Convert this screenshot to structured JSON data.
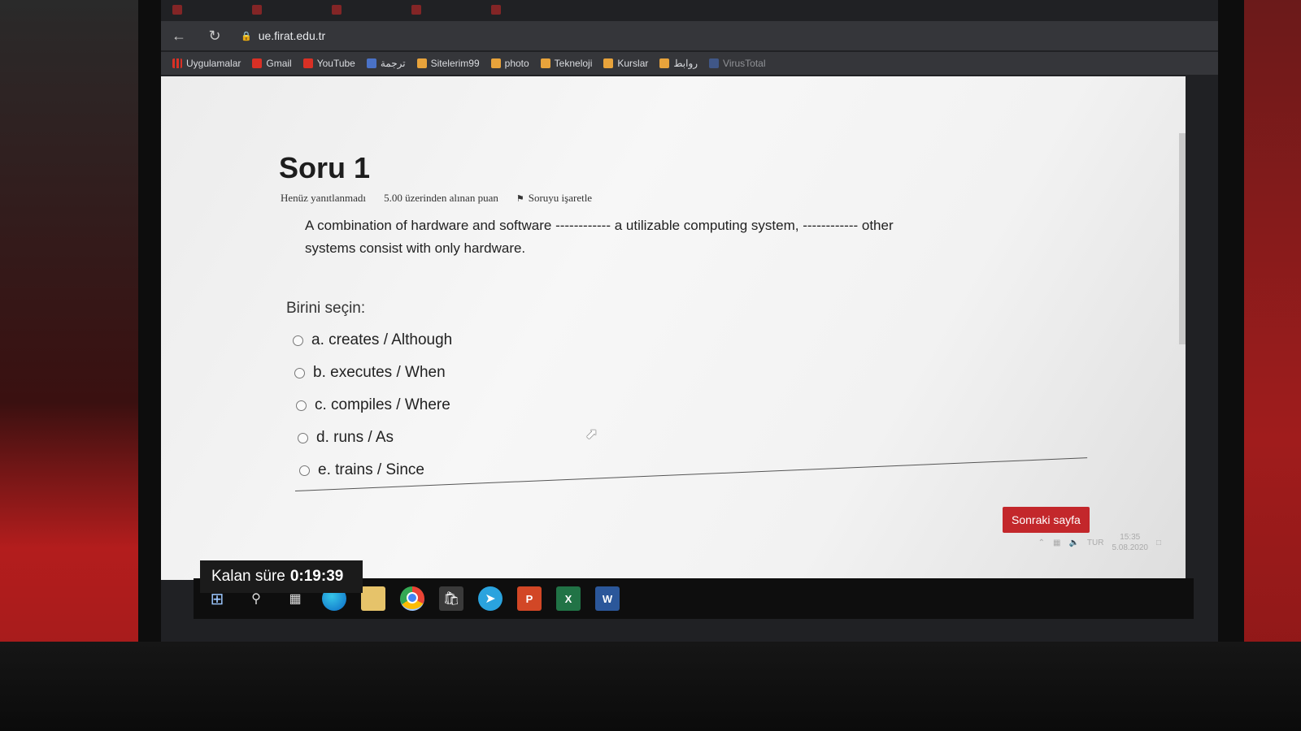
{
  "browser": {
    "url": "ue.firat.edu.tr",
    "bookmarks": [
      {
        "label": "Uygulamalar",
        "icon": "apps-grid-icon"
      },
      {
        "label": "Gmail",
        "icon": "gmail-icon"
      },
      {
        "label": "YouTube",
        "icon": "youtube-icon"
      },
      {
        "label": "ترجمة",
        "icon": "translate-icon"
      },
      {
        "label": "Sitelerim99",
        "icon": "folder-icon"
      },
      {
        "label": "photo",
        "icon": "folder-icon"
      },
      {
        "label": "Tekneloji",
        "icon": "folder-icon"
      },
      {
        "label": "Kurslar",
        "icon": "folder-icon"
      },
      {
        "label": "روابط",
        "icon": "folder-icon"
      },
      {
        "label": "VirusTotal",
        "icon": "virustotal-icon"
      }
    ]
  },
  "quiz": {
    "title": "Soru 1",
    "status": "Henüz yanıtlanmadı",
    "points": "5.00 üzerinden alınan puan",
    "flag_label": "Soruyu işaretle",
    "question_text": "A combination of hardware and software ------------ a utilizable computing system, ------------ other systems consist with only hardware.",
    "choose_label": "Birini seçin:",
    "options": [
      {
        "label": "a. creates / Although"
      },
      {
        "label": "b. executes / When"
      },
      {
        "label": "c. compiles / Where"
      },
      {
        "label": "d. runs / As"
      },
      {
        "label": "e. trains / Since"
      }
    ],
    "next_button": "Sonraki sayfa"
  },
  "timer": {
    "label": "Kalan süre",
    "value": "0:19:39"
  },
  "taskbar": {
    "tray_lang": "TUR",
    "time": "15:35",
    "date": "5.08.2020"
  },
  "colors": {
    "next_button": "#c3272b",
    "taskbar": "#0e0e0e",
    "page_bg": "#f4f4f4"
  }
}
